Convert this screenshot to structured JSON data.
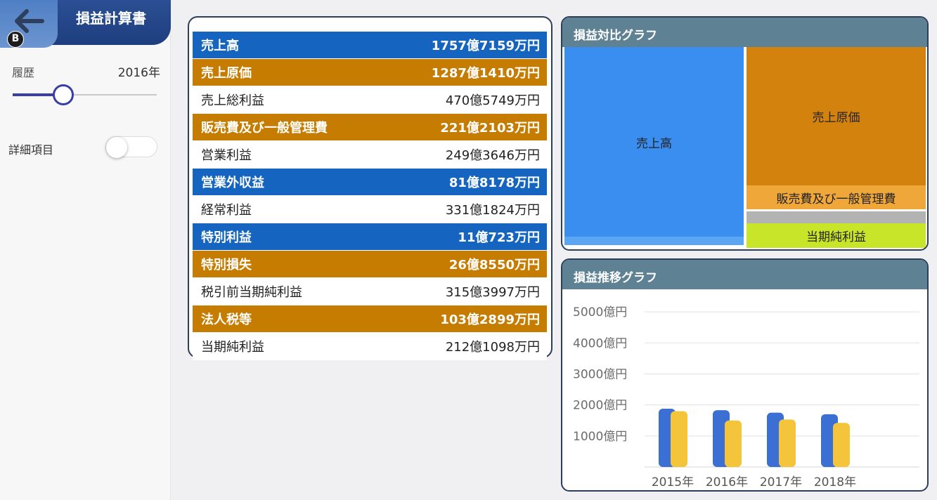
{
  "app": {
    "title": "損益計算書",
    "back_badge": "B"
  },
  "sidebar": {
    "history_label": "履歴",
    "history_year": "2016年",
    "slider_value_fraction": 0.35,
    "detail_label": "詳細項目",
    "detail_toggle_on": false
  },
  "table": {
    "rows": [
      {
        "label": "売上高",
        "value": "1757億7159万円",
        "style": "blue"
      },
      {
        "label": "売上原価",
        "value": "1287億1410万円",
        "style": "orange"
      },
      {
        "label": "売上総利益",
        "value": "470億5749万円",
        "style": "plain"
      },
      {
        "label": "販売費及び一般管理費",
        "value": "221億2103万円",
        "style": "orange"
      },
      {
        "label": "営業利益",
        "value": "249億3646万円",
        "style": "plain"
      },
      {
        "label": "営業外収益",
        "value": "81億8178万円",
        "style": "blue"
      },
      {
        "label": "経常利益",
        "value": "331億1824万円",
        "style": "plain"
      },
      {
        "label": "特別利益",
        "value": "11億723万円",
        "style": "blue"
      },
      {
        "label": "特別損失",
        "value": "26億8550万円",
        "style": "orange"
      },
      {
        "label": "税引前当期純利益",
        "value": "315億3997万円",
        "style": "plain"
      },
      {
        "label": "法人税等",
        "value": "103億2899万円",
        "style": "orange"
      },
      {
        "label": "当期純利益",
        "value": "212億1098万円",
        "style": "plain"
      }
    ]
  },
  "compare_panel": {
    "title": "損益対比グラフ",
    "cells": {
      "sales": "売上高",
      "cogs": "売上原価",
      "sga": "販売費及び一般管理費",
      "net": "当期純利益"
    }
  },
  "trend_panel": {
    "title": "損益推移グラフ"
  },
  "colors": {
    "blue_row": "#1565c0",
    "orange_row": "#c67c00",
    "treemap_sales": "#3a8ef0",
    "treemap_cogs": "#d4820e",
    "treemap_sga": "#f0a73a",
    "treemap_net": "#c8e52a",
    "series_blue": "#3b6fd4",
    "series_yellow": "#f4c43a"
  },
  "chart_data": {
    "type": "bar",
    "categories": [
      "2015年",
      "2016年",
      "2017年",
      "2018年"
    ],
    "series": [
      {
        "values": [
          1880,
          1830,
          1750,
          1700
        ]
      },
      {
        "values": [
          1800,
          1500,
          1530,
          1420
        ]
      }
    ],
    "ytick_labels": [
      "1000億円",
      "2000億円",
      "3000億円",
      "4000億円",
      "5000億円"
    ],
    "yticks": [
      1000,
      2000,
      3000,
      4000,
      5000
    ],
    "ylim": [
      0,
      5500
    ],
    "grid": true
  }
}
